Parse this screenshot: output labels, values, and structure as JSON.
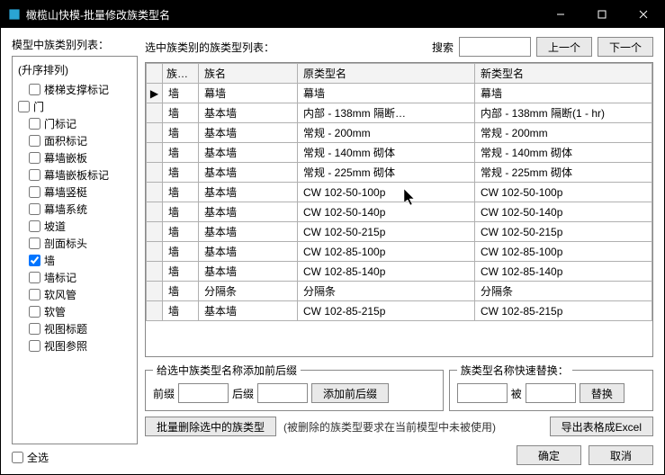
{
  "title": "橄榄山快模-批量修改族类型名",
  "left": {
    "label": "模型中族类别列表：",
    "sort_header": "(升序排列)",
    "items": [
      {
        "label": "楼梯支撑标记",
        "indent": true,
        "checked": false
      },
      {
        "label": "门",
        "indent": false,
        "checked": false
      },
      {
        "label": "门标记",
        "indent": true,
        "checked": false
      },
      {
        "label": "面积标记",
        "indent": true,
        "checked": false
      },
      {
        "label": "幕墙嵌板",
        "indent": true,
        "checked": false
      },
      {
        "label": "幕墙嵌板标记",
        "indent": true,
        "checked": false
      },
      {
        "label": "幕墙竖梃",
        "indent": true,
        "checked": false
      },
      {
        "label": "幕墙系统",
        "indent": true,
        "checked": false
      },
      {
        "label": "坡道",
        "indent": true,
        "checked": false
      },
      {
        "label": "剖面标头",
        "indent": true,
        "checked": false
      },
      {
        "label": "墙",
        "indent": true,
        "checked": true
      },
      {
        "label": "墙标记",
        "indent": true,
        "checked": false
      },
      {
        "label": "软风管",
        "indent": true,
        "checked": false
      },
      {
        "label": "软管",
        "indent": true,
        "checked": false
      },
      {
        "label": "视图标题",
        "indent": true,
        "checked": false
      },
      {
        "label": "视图参照",
        "indent": true,
        "checked": false
      }
    ],
    "select_all": "全选"
  },
  "topbar": {
    "label_main": "选中族类别的族类型列表：",
    "search_label": "搜索",
    "search_value": "",
    "prev": "上一个",
    "next": "下一个"
  },
  "grid": {
    "headers": {
      "cat": "族类别",
      "name": "族名",
      "orig": "原类型名",
      "new": "新类型名"
    },
    "rows": [
      {
        "cat": "墙",
        "name": "幕墙",
        "orig": "幕墙",
        "new": "幕墙",
        "marker": "▶"
      },
      {
        "cat": "墙",
        "name": "基本墙",
        "orig": "内部 - 138mm 隔断…",
        "new": "内部 - 138mm 隔断(1 - hr)"
      },
      {
        "cat": "墙",
        "name": "基本墙",
        "orig": "常规 - 200mm",
        "new": "常规 - 200mm"
      },
      {
        "cat": "墙",
        "name": "基本墙",
        "orig": "常规 - 140mm 砌体",
        "new": "常规 - 140mm 砌体"
      },
      {
        "cat": "墙",
        "name": "基本墙",
        "orig": "常规 - 225mm 砌体",
        "new": "常规 - 225mm 砌体"
      },
      {
        "cat": "墙",
        "name": "基本墙",
        "orig": "CW 102-50-100p",
        "new": "CW 102-50-100p"
      },
      {
        "cat": "墙",
        "name": "基本墙",
        "orig": "CW 102-50-140p",
        "new": "CW 102-50-140p"
      },
      {
        "cat": "墙",
        "name": "基本墙",
        "orig": "CW 102-50-215p",
        "new": "CW 102-50-215p"
      },
      {
        "cat": "墙",
        "name": "基本墙",
        "orig": "CW 102-85-100p",
        "new": "CW 102-85-100p"
      },
      {
        "cat": "墙",
        "name": "基本墙",
        "orig": "CW 102-85-140p",
        "new": "CW 102-85-140p"
      },
      {
        "cat": "墙",
        "name": "分隔条",
        "orig": "分隔条",
        "new": "分隔条"
      },
      {
        "cat": "墙",
        "name": "基本墙",
        "orig": "CW 102-85-215p",
        "new": "CW 102-85-215p"
      }
    ]
  },
  "prefixSuffix": {
    "legend": "给选中族类型名称添加前后缀",
    "prefix_label": "前缀",
    "suffix_label": "后缀",
    "apply": "添加前后缀"
  },
  "replace": {
    "legend": "族类型名称快速替换：",
    "with_label": "被",
    "apply": "替换"
  },
  "bottom": {
    "delete": "批量删除选中的族类型",
    "note": "(被删除的族类型要求在当前模型中未被使用)",
    "export": "导出表格成Excel",
    "ok": "确定",
    "cancel": "取消"
  }
}
